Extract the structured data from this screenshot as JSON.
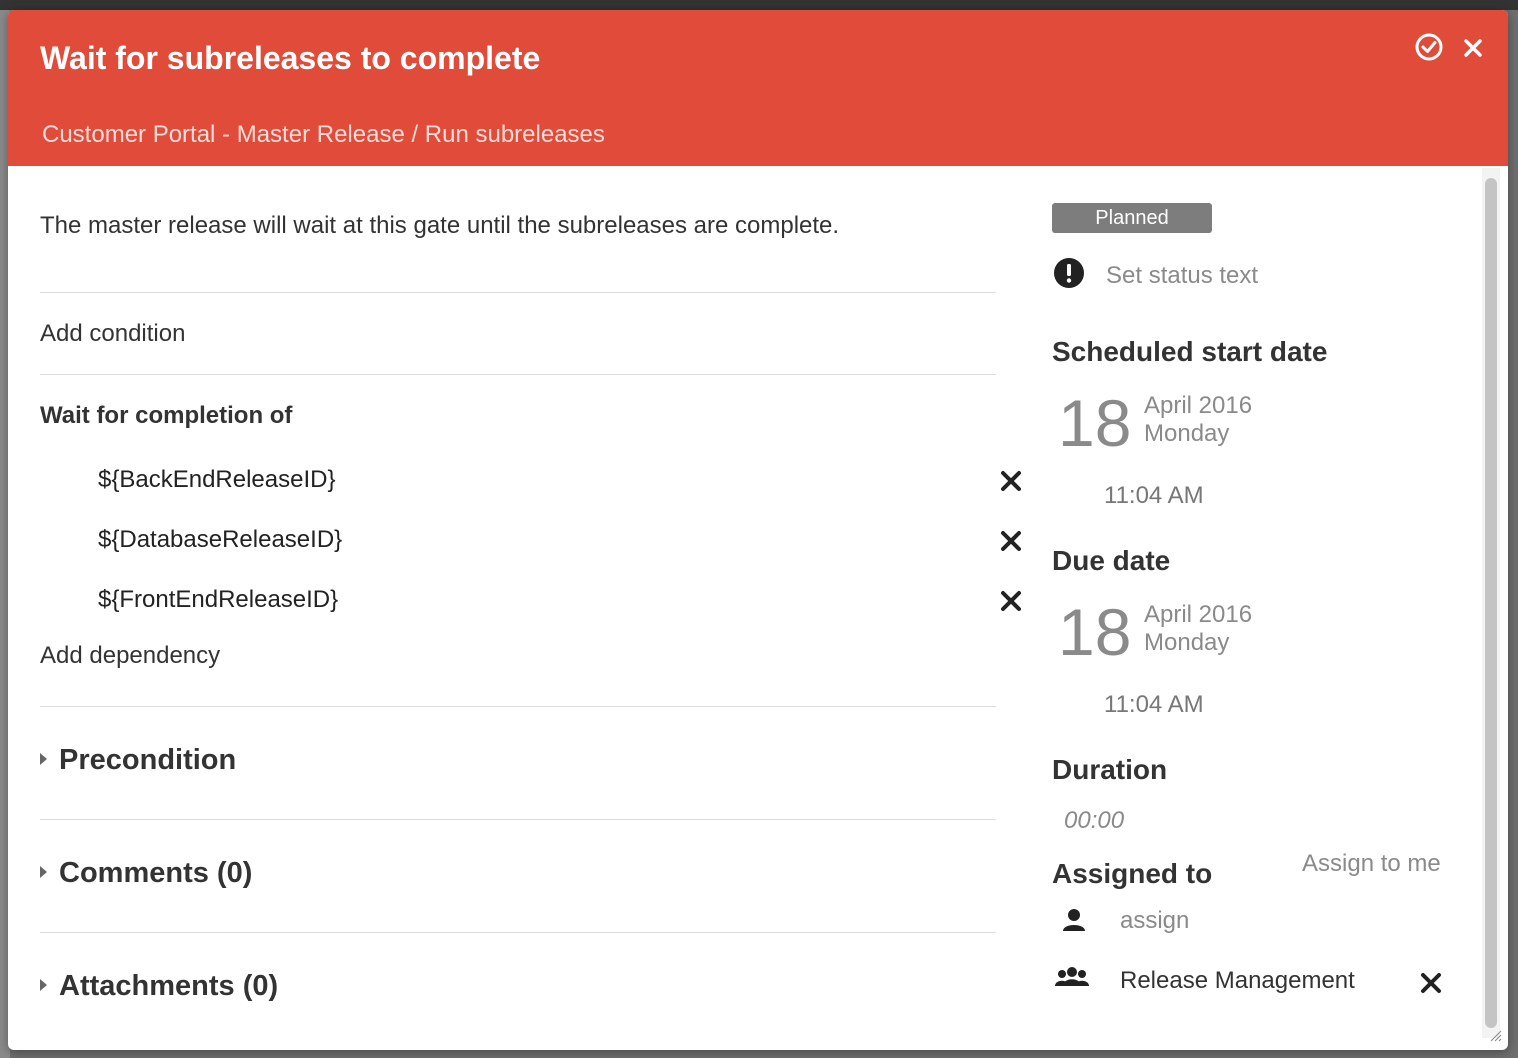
{
  "dialog": {
    "title": "Wait for subreleases to complete",
    "breadcrumb": "Customer Portal - Master Release / Run subreleases",
    "header_color": "#e04b3a",
    "icons": {
      "complete": "check-circle-icon",
      "close": "close-icon"
    }
  },
  "main": {
    "description": "The master release will wait at this gate until the subreleases are complete.",
    "add_condition": "Add condition",
    "wait_label": "Wait for completion of",
    "dependencies": [
      {
        "label": "${BackEndReleaseID}"
      },
      {
        "label": "${DatabaseReleaseID}"
      },
      {
        "label": "${FrontEndReleaseID}"
      }
    ],
    "add_dependency": "Add dependency",
    "sections": {
      "precondition": "Precondition",
      "comments": "Comments (0)",
      "attachments": "Attachments (0)"
    }
  },
  "sidebar": {
    "status": "Planned",
    "status_color": "#7d7d7d",
    "status_text_placeholder": "Set status text",
    "scheduled_start": {
      "label": "Scheduled start date",
      "day": "18",
      "month_year": "April 2016",
      "weekday": "Monday",
      "time": "11:04 AM"
    },
    "due": {
      "label": "Due date",
      "day": "18",
      "month_year": "April 2016",
      "weekday": "Monday",
      "time": "11:04 AM"
    },
    "duration": {
      "label": "Duration",
      "value": "00:00"
    },
    "assigned": {
      "label": "Assigned to",
      "assign_to_me": "Assign to me",
      "assign": "assign",
      "team": "Release Management"
    }
  }
}
